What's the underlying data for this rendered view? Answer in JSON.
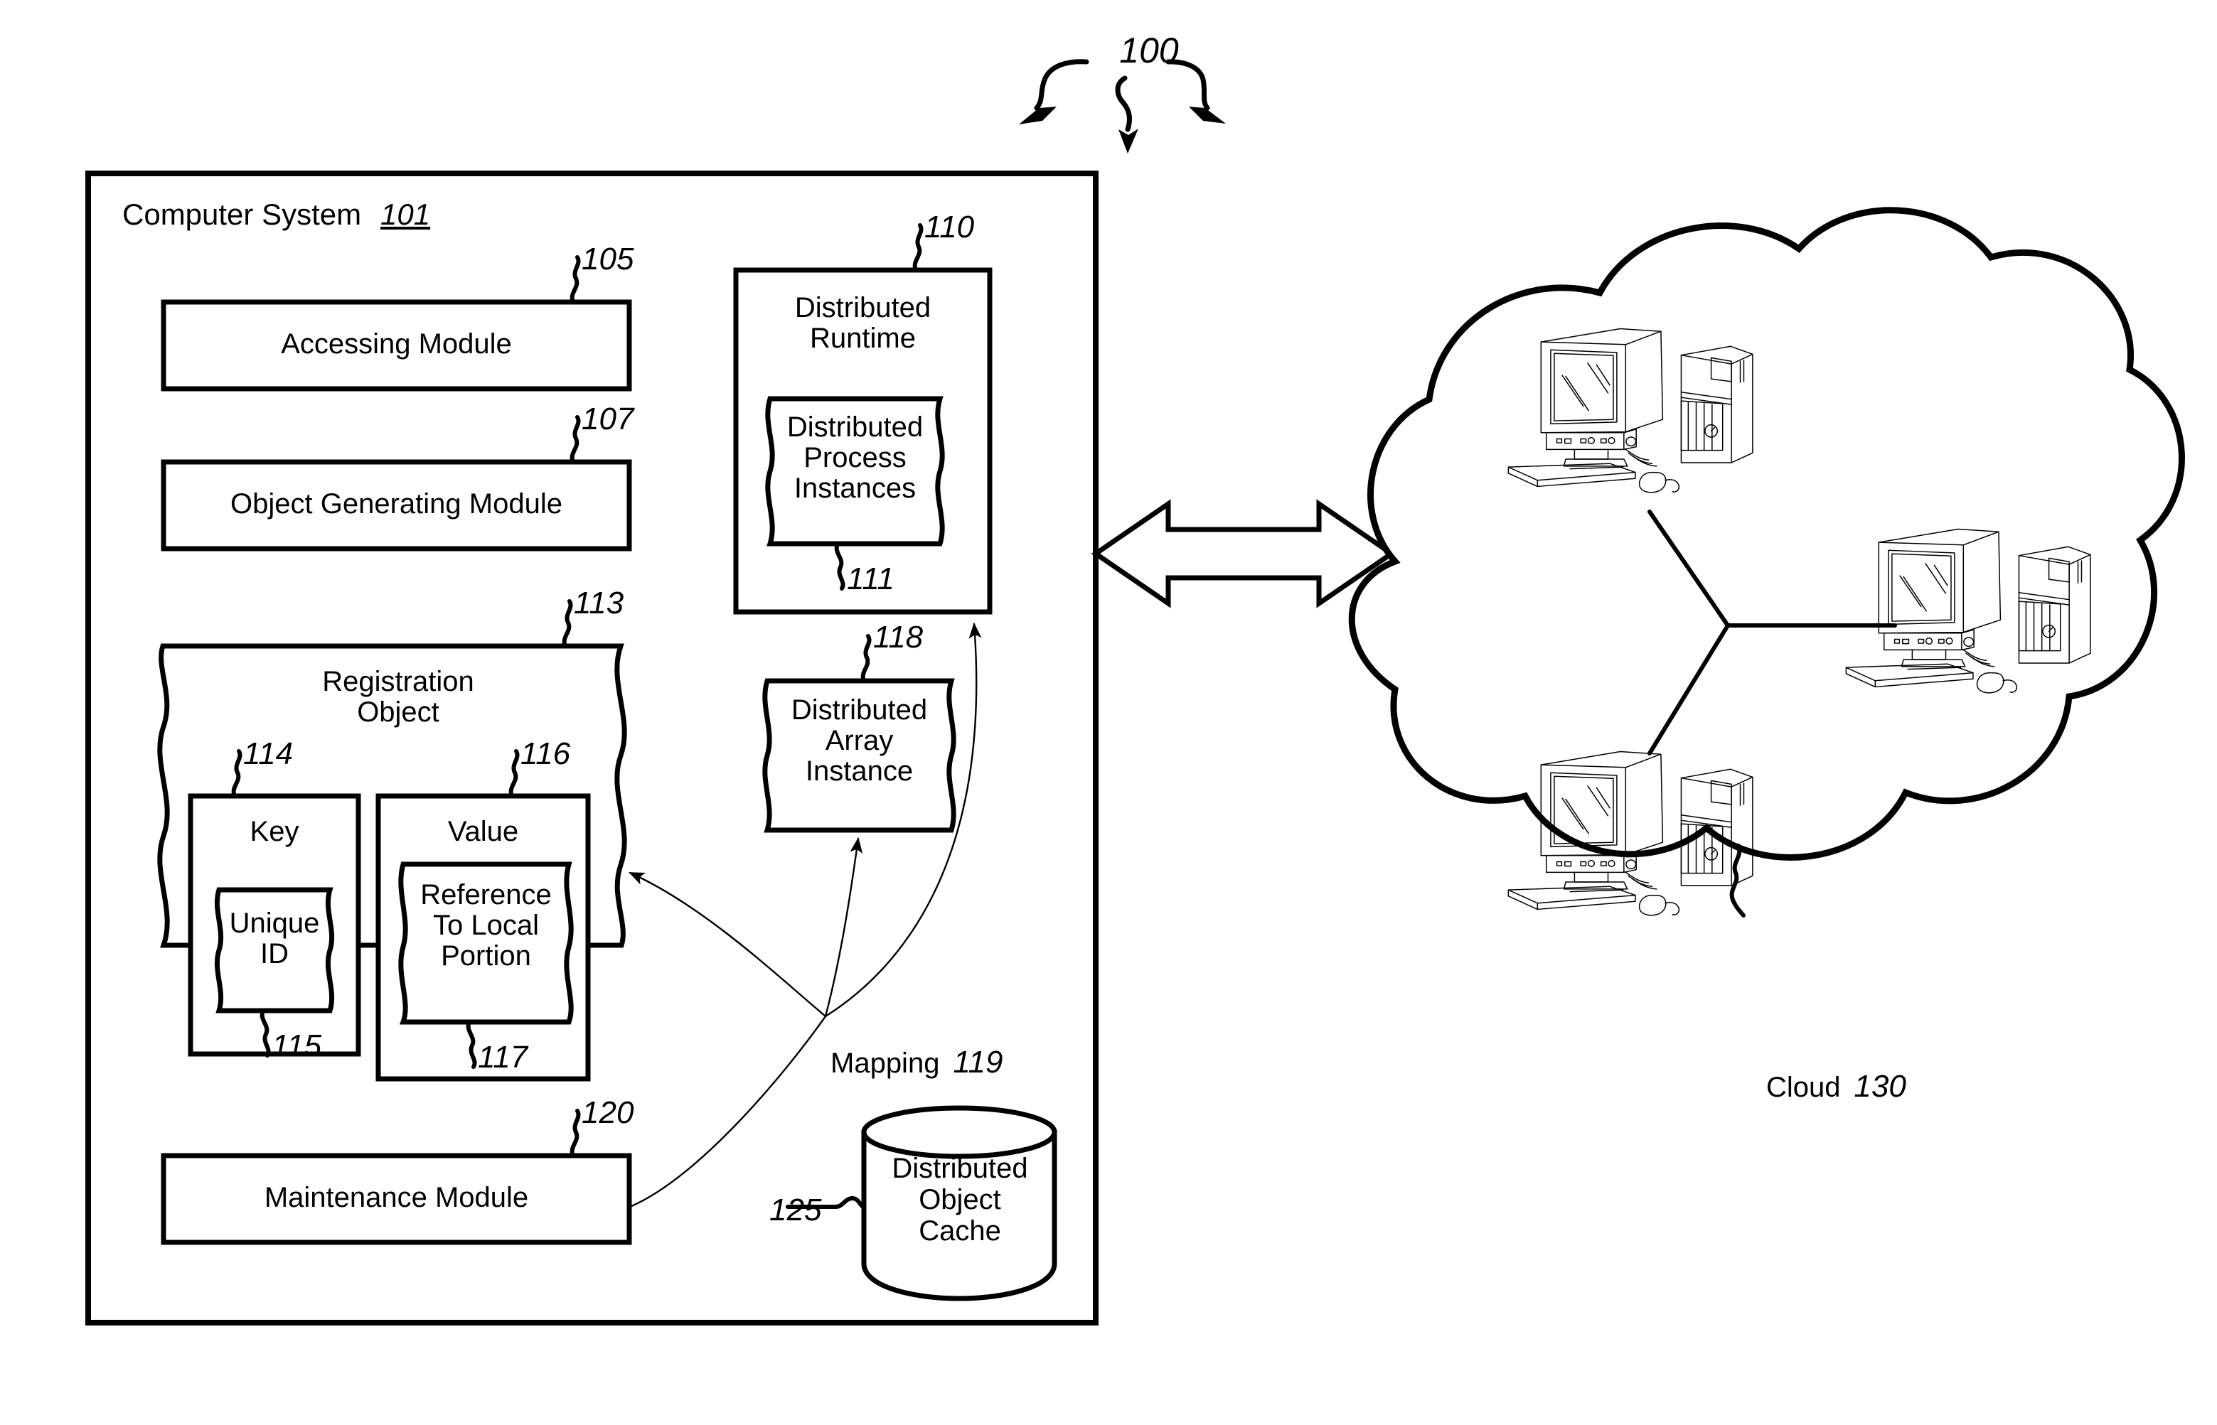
{
  "figure": {
    "figure_number": "100",
    "computer_system": {
      "label": "Computer System",
      "ref": "101",
      "modules": [
        {
          "label": "Accessing Module",
          "ref": "105"
        },
        {
          "label": "Object Generating Module",
          "ref": "107"
        },
        {
          "label": "Maintenance Module",
          "ref": "120"
        }
      ],
      "distributed_runtime": {
        "label_line1": "Distributed",
        "label_line2": "Runtime",
        "ref": "110",
        "inner": {
          "label_line1": "Distributed",
          "label_line2": "Process",
          "label_line3": "Instances",
          "ref": "111"
        }
      },
      "distributed_array_instance": {
        "label_line1": "Distributed",
        "label_line2": "Array",
        "label_line3": "Instance",
        "ref": "118"
      },
      "registration_object": {
        "label_line1": "Registration",
        "label_line2": "Object",
        "ref": "113",
        "key": {
          "label": "Key",
          "ref": "114",
          "inner": {
            "label_line1": "Unique",
            "label_line2": "ID",
            "ref": "115"
          }
        },
        "value": {
          "label": "Value",
          "ref": "116",
          "inner": {
            "label_line1": "Reference",
            "label_line2": "To Local",
            "label_line3": "Portion",
            "ref": "117"
          }
        }
      },
      "mapping": {
        "label": "Mapping",
        "ref": "119"
      },
      "distributed_object_cache": {
        "label_line1": "Distributed",
        "label_line2": "Object",
        "label_line3": "Cache",
        "ref": "125"
      }
    },
    "cloud": {
      "label": "Cloud",
      "ref": "130",
      "node_count": 3,
      "nodes": [
        {
          "name": "computer-node-top-left"
        },
        {
          "name": "computer-node-middle-right"
        },
        {
          "name": "computer-node-bottom-left"
        }
      ]
    },
    "connector": {
      "name": "bidirectional-arrow",
      "direction": "both"
    },
    "colors": {
      "line": "#000000",
      "background": "#ffffff"
    }
  }
}
